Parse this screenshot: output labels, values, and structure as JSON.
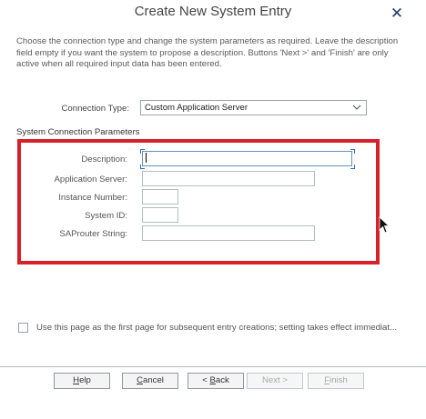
{
  "dialog": {
    "title": "Create New System Entry",
    "close_glyph": "✕",
    "instructions": "Choose the connection type and change the system parameters as required. Leave the description field empty if you want the system to propose a description. Buttons 'Next >' and 'Finish' are only active when all required input data has been entered."
  },
  "connection": {
    "label": "Connection Type:",
    "selected": "Custom Application Server"
  },
  "params": {
    "section_title": "System Connection Parameters",
    "fields": [
      {
        "label": "Description:",
        "value": ""
      },
      {
        "label": "Application Server:",
        "value": ""
      },
      {
        "label": "Instance Number:",
        "value": ""
      },
      {
        "label": "System ID:",
        "value": ""
      },
      {
        "label": "SAProuter String:",
        "value": ""
      }
    ]
  },
  "options": {
    "first_page_label": "Use this page as the first page for subsequent entry creations; setting takes effect immediat..."
  },
  "buttons": {
    "help": {
      "accel": "H",
      "rest": "elp"
    },
    "cancel": {
      "accel": "C",
      "rest": "ancel"
    },
    "back": {
      "prefix": "< ",
      "accel": "B",
      "rest": "ack"
    },
    "next": "Next >",
    "finish": {
      "accel": "F",
      "rest": "inish"
    }
  },
  "colors": {
    "highlight": "#d8202a",
    "focus_accent": "#2f6fb5"
  }
}
